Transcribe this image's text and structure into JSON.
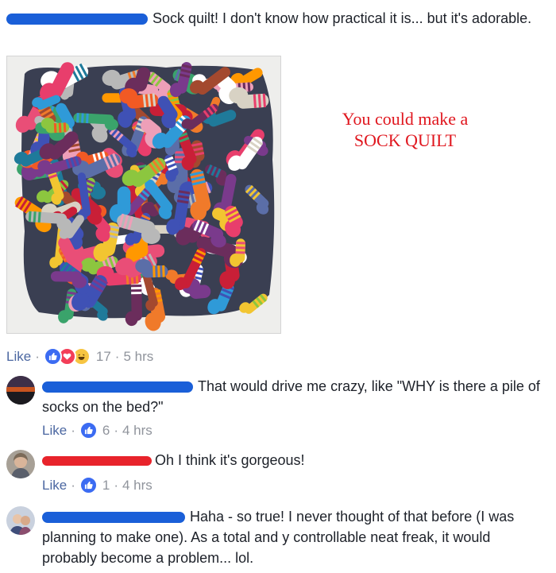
{
  "post": {
    "text": "Sock quilt! I don't know how practical it is... but it's adorable.",
    "image_caption_line1": "You could make a",
    "image_caption_line2": "SOCK QUILT",
    "like_label": "Like",
    "sep": "·",
    "reaction_count": "17",
    "time": "5 hrs",
    "reactions": [
      "like-icon",
      "love-icon",
      "haha-icon"
    ]
  },
  "comments": [
    {
      "text": "That would drive me crazy, like \"WHY is there a pile of socks on the bed?\"",
      "like_label": "Like",
      "sep": "·",
      "reaction_count": "6",
      "time": "4 hrs"
    },
    {
      "text": "Oh I think it's gorgeous!",
      "like_label": "Like",
      "sep": "·",
      "reaction_count": "1",
      "time": "4 hrs"
    },
    {
      "text": "Haha - so true! I never thought of that before (I was planning to make one). As a total and y controllable neat freak, it would probably become a problem... lol."
    }
  ],
  "colors": {
    "link": "#4b67a1",
    "meta": "#90949c",
    "like_blue": "#3b6bf2",
    "redaction_blue": "#1a5fd8",
    "redaction_red": "#e8232b",
    "caption_red": "#e0161e"
  }
}
